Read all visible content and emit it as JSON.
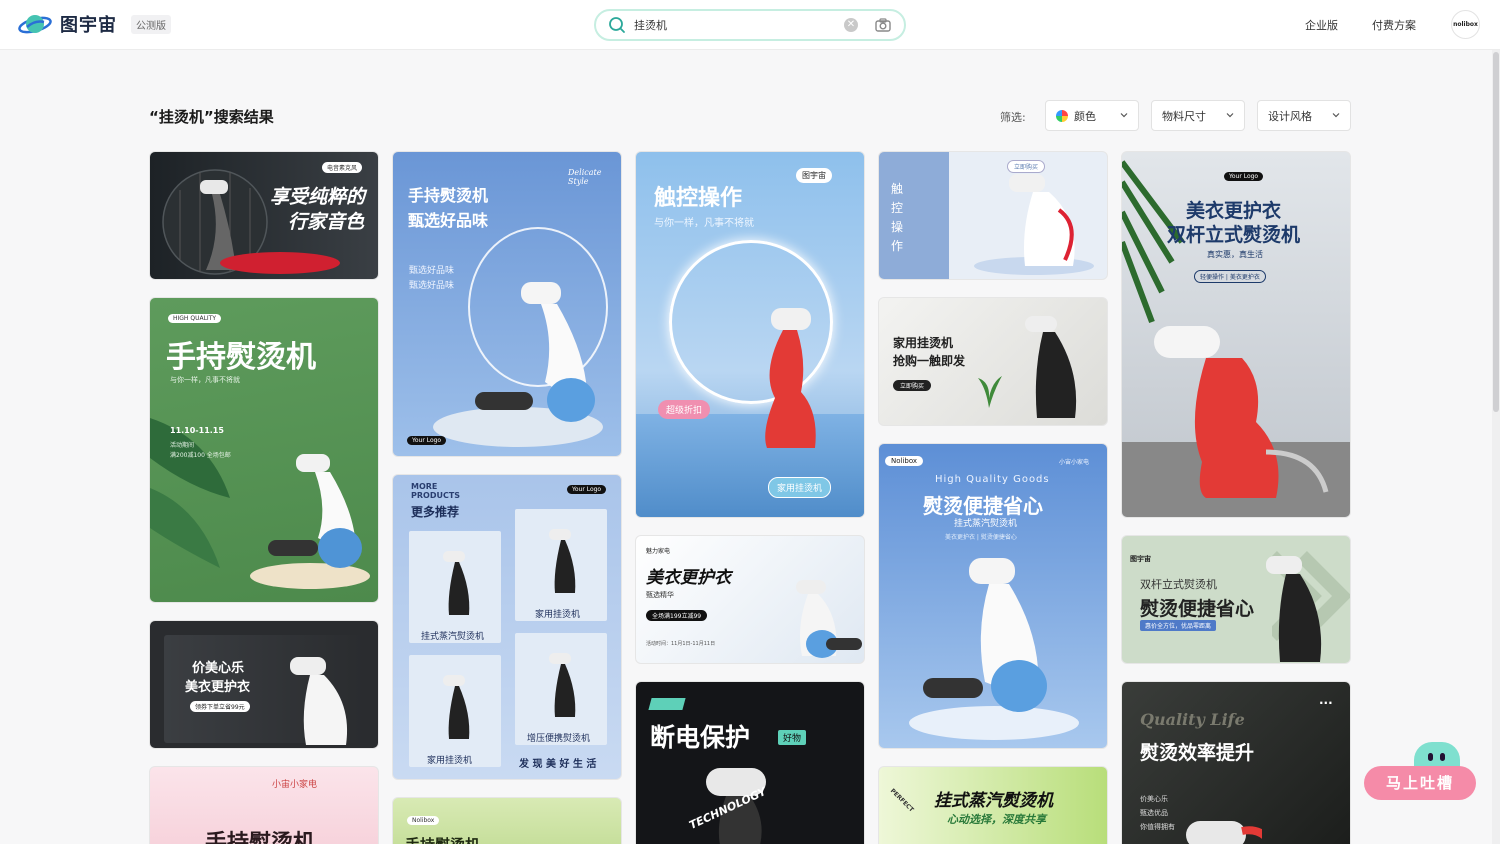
{
  "header": {
    "logo_text": "图宇宙",
    "beta_label": "公测版",
    "search_value": "挂烫机",
    "nav_enterprise": "企业版",
    "nav_pricing": "付费方案",
    "avatar_text": "nolibox"
  },
  "results": {
    "title": "“挂烫机”搜索结果",
    "filter_label": "筛选:",
    "filters": {
      "color": "颜色",
      "size": "物料尺寸",
      "style": "设计风格"
    }
  },
  "cards": {
    "c1": {
      "tag": "电音素克风",
      "title1": "享受纯粹的",
      "title2": "行家音色"
    },
    "c2": {
      "tag": "HIGH QUALITY",
      "title": "手持熨烫机",
      "sub": "与你一样，凡事不将就",
      "date": "11.10-11.15",
      "note1": "活动期间",
      "note2": "满200减100 全场包邮"
    },
    "c3": {
      "title1": "价美心乐",
      "title2": "美衣更护衣",
      "badge": "领券下单立省99元"
    },
    "c4": {
      "brand": "小宙小家电",
      "title": "手持熨烫机"
    },
    "c5": {
      "script": "Delicate Style",
      "title1": "手持熨烫机",
      "title2": "甄选好品味",
      "sub1": "甄选好品味",
      "sub2": "甄选好品味",
      "logo": "Your Logo"
    },
    "c6": {
      "en1": "MORE",
      "en2": "PRODUCTS",
      "title": "更多推荐",
      "logo": "Your Logo",
      "l1": "家用挂烫机",
      "l2": "挂式蒸汽熨烫机",
      "l3": "增压便携熨烫机",
      "l4": "家用挂烫机",
      "foot": "发 现 美 好 生 活"
    },
    "c7": {
      "brand": "Nolibox",
      "title": "手持熨烫机"
    },
    "c8": {
      "title": "触控操作",
      "sub": "与你一样，凡事不将就",
      "brand": "图宇宙",
      "pill1": "超级折扣",
      "pill2": "家用挂烫机"
    },
    "c9": {
      "brand": "魅力家电",
      "title": "美衣更护衣",
      "sub": "甄选精华",
      "badge": "全场满199立减99",
      "date": "活动时间：11月1日-11月11日"
    },
    "c10": {
      "title": "断电保护",
      "badge": "好物",
      "deco": "TECHNOLOGY"
    },
    "c11": {
      "vertical": "触控操作",
      "btn": "立即购买"
    },
    "c12": {
      "title1": "家用挂烫机",
      "title2": "抢购一触即发",
      "btn": "立即购买"
    },
    "c13": {
      "brand": "Nolibox",
      "tag": "小宙小家电",
      "en": "High Quality Goods",
      "title": "熨烫便捷省心",
      "sub": "挂式蒸汽熨烫机",
      "sub2": "美衣更护衣 | 熨烫便捷省心"
    },
    "c14": {
      "corner": "PERFECT",
      "title": "挂式蒸汽熨烫机",
      "sub": "心动选择，深度共享"
    },
    "c15": {
      "logo": "Your Logo",
      "title1": "美衣更护衣",
      "title2": "双杆立式熨烫机",
      "sub": "真实惠，真生活",
      "tags": "轻便操作 | 美衣更护衣"
    },
    "c16": {
      "brand": "图宇宙",
      "title1": "双杆立式熨烫机",
      "title2": "熨烫便捷省心",
      "badge": "惠价全方位，优品零距离"
    },
    "c17": {
      "script": "Quality Life",
      "title": "熨烫效率提升",
      "l1": "价美心乐",
      "l2": "甄选优品",
      "l3": "你值得拥有"
    }
  },
  "feedback": {
    "label": "马上吐槽"
  }
}
